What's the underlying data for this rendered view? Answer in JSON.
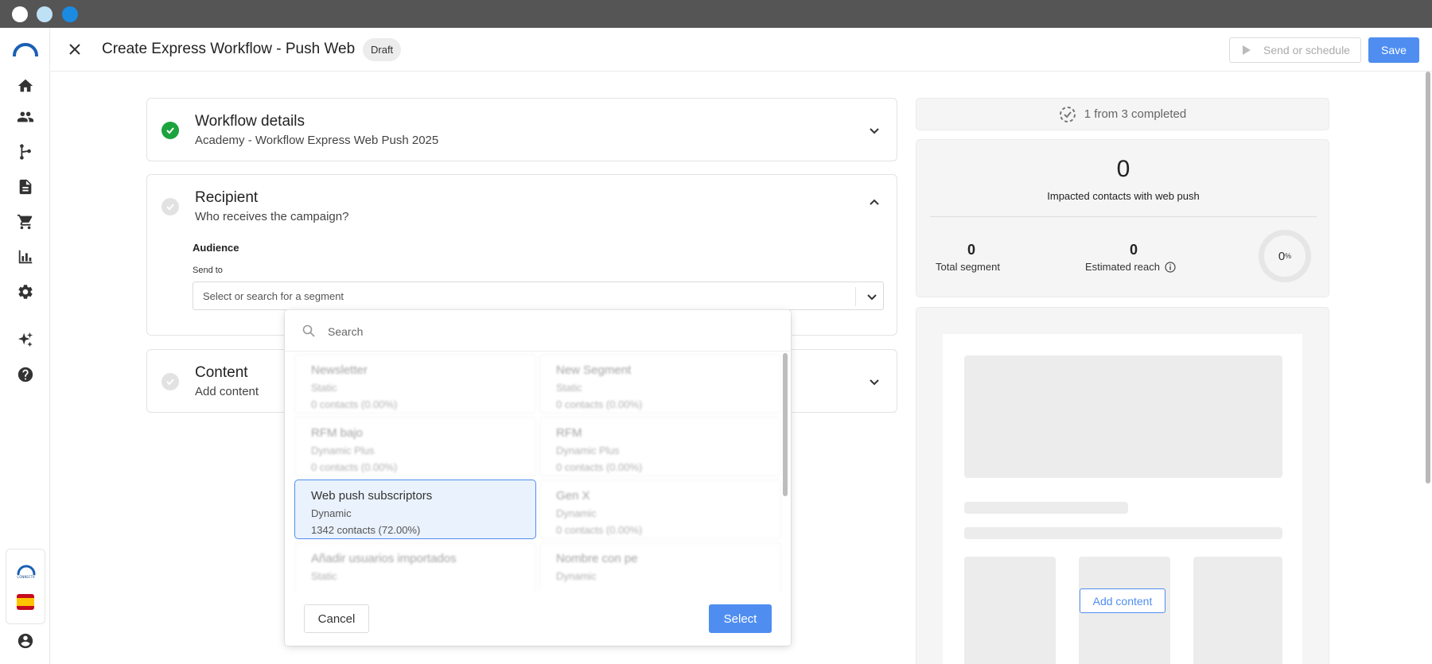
{
  "header": {
    "title": "Create Express Workflow - Push Web",
    "status_badge": "Draft",
    "send_label": "Send or schedule",
    "save_label": "Save"
  },
  "sidebar": {
    "items": [
      {
        "icon": "home-icon"
      },
      {
        "icon": "contacts-icon"
      },
      {
        "icon": "workflow-icon"
      },
      {
        "icon": "document-icon"
      },
      {
        "icon": "cart-icon"
      },
      {
        "icon": "analytics-icon"
      },
      {
        "icon": "gear-icon"
      },
      {
        "icon": "sparkles-icon"
      },
      {
        "icon": "help-icon"
      }
    ],
    "brand_text": "CONNECTIF",
    "language_flag": "es"
  },
  "sections": {
    "workflow_details": {
      "title": "Workflow details",
      "subtitle": "Academy - Workflow Express Web Push 2025",
      "completed": true
    },
    "recipient": {
      "title": "Recipient",
      "subtitle": "Who receives the campaign?",
      "audience_label": "Audience",
      "send_to_label": "Send to",
      "segment_placeholder": "Select or search for a segment",
      "completed": false
    },
    "content": {
      "title": "Content",
      "subtitle": "Add content",
      "completed": false
    }
  },
  "segment_dropdown": {
    "search_placeholder": "Search",
    "segments": [
      {
        "name": "Newsletter",
        "type": "Static",
        "contacts": "0 contacts (0.00%)"
      },
      {
        "name": "New Segment",
        "type": "Static",
        "contacts": "0 contacts (0.00%)"
      },
      {
        "name": "RFM bajo",
        "type": "Dynamic Plus",
        "contacts": "0 contacts (0.00%)"
      },
      {
        "name": "RFM",
        "type": "Dynamic Plus",
        "contacts": "0 contacts (0.00%)"
      },
      {
        "name": "Web push subscriptors",
        "type": "Dynamic",
        "contacts": "1342 contacts (72.00%)",
        "selected": true
      },
      {
        "name": "Gen X",
        "type": "Dynamic",
        "contacts": "0 contacts (0.00%)"
      },
      {
        "name": "Añadir usuarios importados",
        "type": "Static",
        "contacts": ""
      },
      {
        "name": "Nombre con pe",
        "type": "Dynamic",
        "contacts": ""
      }
    ],
    "cancel_label": "Cancel",
    "select_label": "Select"
  },
  "summary": {
    "progress": "1 from 3 completed",
    "impacted_contacts": "0",
    "impacted_label": "Impacted contacts with web push",
    "total_segment": "0",
    "total_segment_label": "Total segment",
    "estimated_reach": "0",
    "estimated_reach_label": "Estimated reach",
    "reach_percent": "0",
    "reach_percent_unit": "%",
    "add_content_label": "Add content"
  },
  "colors": {
    "accent": "#4f8ef0",
    "success": "#1ca33e",
    "titlebar": "#555555"
  }
}
